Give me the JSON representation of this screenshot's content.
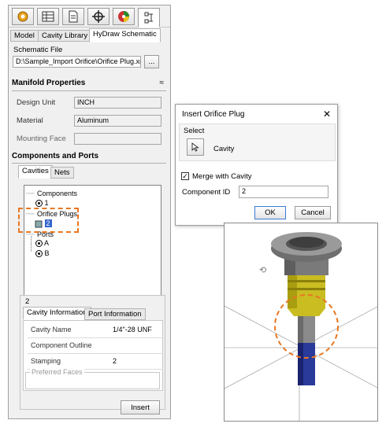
{
  "panel": {
    "toolbar": {
      "icons": [
        "gear-palette-icon",
        "table-icon",
        "document-icon",
        "crosshair-icon",
        "color-sphere-icon",
        "schematic-icon"
      ]
    },
    "tabs": [
      "Model",
      "Cavity Library",
      "HyDraw Schematic"
    ],
    "schematic_file": {
      "label": "Schematic File",
      "value": "D:\\Sample_Import Orifice\\Orifice Plug.xml",
      "browse_label": "..."
    },
    "manifold": {
      "title": "Manifold Properties",
      "design_unit_label": "Design Unit",
      "design_unit_value": "INCH",
      "material_label": "Material",
      "material_value": "Aluminum",
      "mounting_face_label": "Mounting Face",
      "mounting_face_value": ""
    },
    "components": {
      "title": "Components and Ports",
      "tabs": [
        "Cavities",
        "Nets"
      ],
      "tree": {
        "components_label": "Components",
        "component_1": "1",
        "orifice_label": "Orifice Plugs",
        "orifice_item": "2",
        "ports_label": "Ports",
        "port_a": "A",
        "port_b": "B"
      }
    },
    "details": {
      "id": "2",
      "tabs": [
        "Cavity Information",
        "Port Information"
      ],
      "rows": [
        {
          "key": "Cavity Name",
          "value": "1/4\"-28 UNF"
        },
        {
          "key": "Component Outline",
          "value": ""
        },
        {
          "key": "Stamping",
          "value": "2"
        }
      ],
      "preferred_faces_label": "Preferred Faces"
    },
    "insert_label": "Insert"
  },
  "dialog": {
    "title": "Insert Orifice Plug",
    "close_label": "✕",
    "select_label": "Select",
    "cavity_label": "Cavity",
    "merge_label": "Merge with Cavity",
    "merge_checked": true,
    "component_id_label": "Component ID",
    "component_id_value": "2",
    "ok_label": "OK",
    "cancel_label": "Cancel"
  },
  "colors": {
    "highlight_orange": "#e87722",
    "selection_blue": "#3366cc",
    "plug_yellow": "#d8cc2a",
    "stem_blue": "#1f2e8a"
  }
}
